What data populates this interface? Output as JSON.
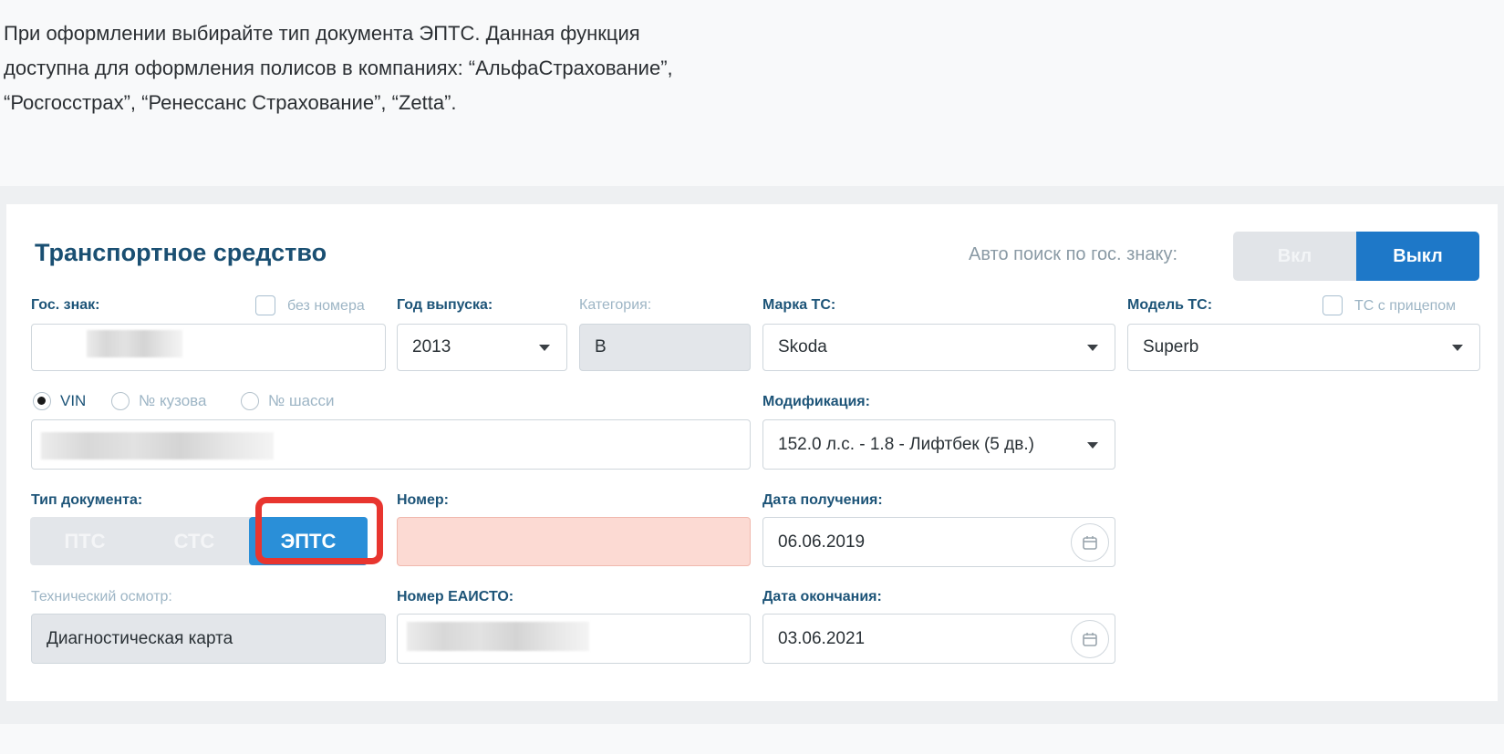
{
  "intro": {
    "line1": "При оформлении выбирайте тип документа ЭПТС. Данная функция",
    "line2": "доступна для оформления полисов в компаниях: “АльфаСтрахование”,",
    "line3": "“Росгосстрах”, “Ренессанс Страхование”, “Zetta”."
  },
  "vehicle": {
    "title": "Транспортное средство",
    "auto_search_label": "Авто поиск по гос. знаку:",
    "toggle_on": "Вкл",
    "toggle_off": "Выкл",
    "plate_label": "Гос. знак:",
    "no_plate_label": "без номера",
    "year_label": "Год выпуска:",
    "year_value": "2013",
    "category_label": "Категория:",
    "category_value": "B",
    "brand_label": "Марка ТС:",
    "brand_value": "Skoda",
    "model_label": "Модель ТС:",
    "trailer_label": "ТС с прицепом",
    "model_value": "Superb",
    "radio_vin": "VIN",
    "radio_body": "№ кузова",
    "radio_chassis": "№ шасси",
    "modification_label": "Модификация:",
    "modification_value": "152.0 л.с. - 1.8 - Лифтбек (5 дв.)",
    "doc_type_label": "Тип документа:",
    "doc_pts": "ПТС",
    "doc_sts": "СТС",
    "doc_epts": "ЭПТС",
    "number_label": "Номер:",
    "date_received_label": "Дата получения:",
    "date_received_value": "06.06.2019",
    "inspection_label": "Технический осмотр:",
    "inspection_value": "Диагностическая карта",
    "eaisto_label": "Номер ЕАИСТО:",
    "date_end_label": "Дата окончания:",
    "date_end_value": "03.06.2021"
  },
  "icons": [
    "calendar-icon",
    "chevron-down-icon"
  ],
  "colors": {
    "accent": "#1e78c8",
    "highlight": "#e8352f",
    "error_fill": "#fcdad3"
  }
}
